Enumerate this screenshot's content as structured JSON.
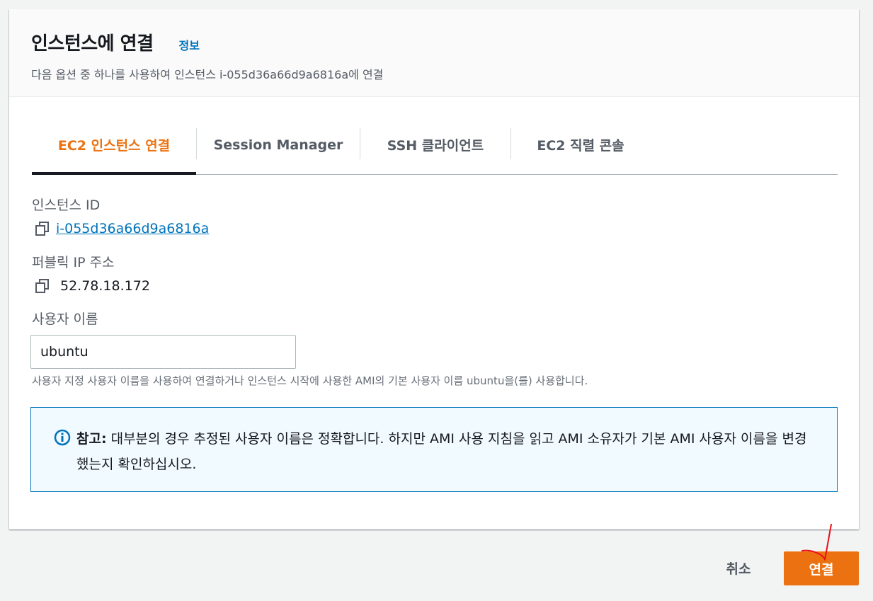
{
  "header": {
    "title": "인스턴스에 연결",
    "info_link": "정보",
    "subtitle": "다음 옵션 중 하나를 사용하여 인스턴스 i-055d36a66d9a6816a에 연결"
  },
  "tabs": [
    {
      "label": "EC2 인스턴스 연결",
      "active": true
    },
    {
      "label": "Session Manager",
      "active": false
    },
    {
      "label": "SSH 클라이언트",
      "active": false
    },
    {
      "label": "EC2 직렬 콘솔",
      "active": false
    }
  ],
  "fields": {
    "instance_id_label": "인스턴스 ID",
    "instance_id_value": "i-055d36a66d9a6816a",
    "public_ip_label": "퍼블릭 IP 주소",
    "public_ip_value": "52.78.18.172",
    "username_label": "사용자 이름",
    "username_value": "ubuntu",
    "username_hint": "사용자 지정 사용자 이름을 사용하여 연결하거나 인스턴스 시작에 사용한 AMI의 기본 사용자 이름 ubuntu을(를) 사용합니다."
  },
  "alert": {
    "prefix": "참고:",
    "text": " 대부분의 경우 추정된 사용자 이름은 정확합니다. 하지만 AMI 사용 지침을 읽고 AMI 소유자가 기본 AMI 사용자 이름을 변경했는지 확인하십시오."
  },
  "footer": {
    "cancel_label": "취소",
    "connect_label": "연결"
  },
  "colors": {
    "accent": "#ec7211",
    "link": "#0073bb",
    "alert_bg": "#f1faff",
    "annotation": "#e8101a"
  }
}
